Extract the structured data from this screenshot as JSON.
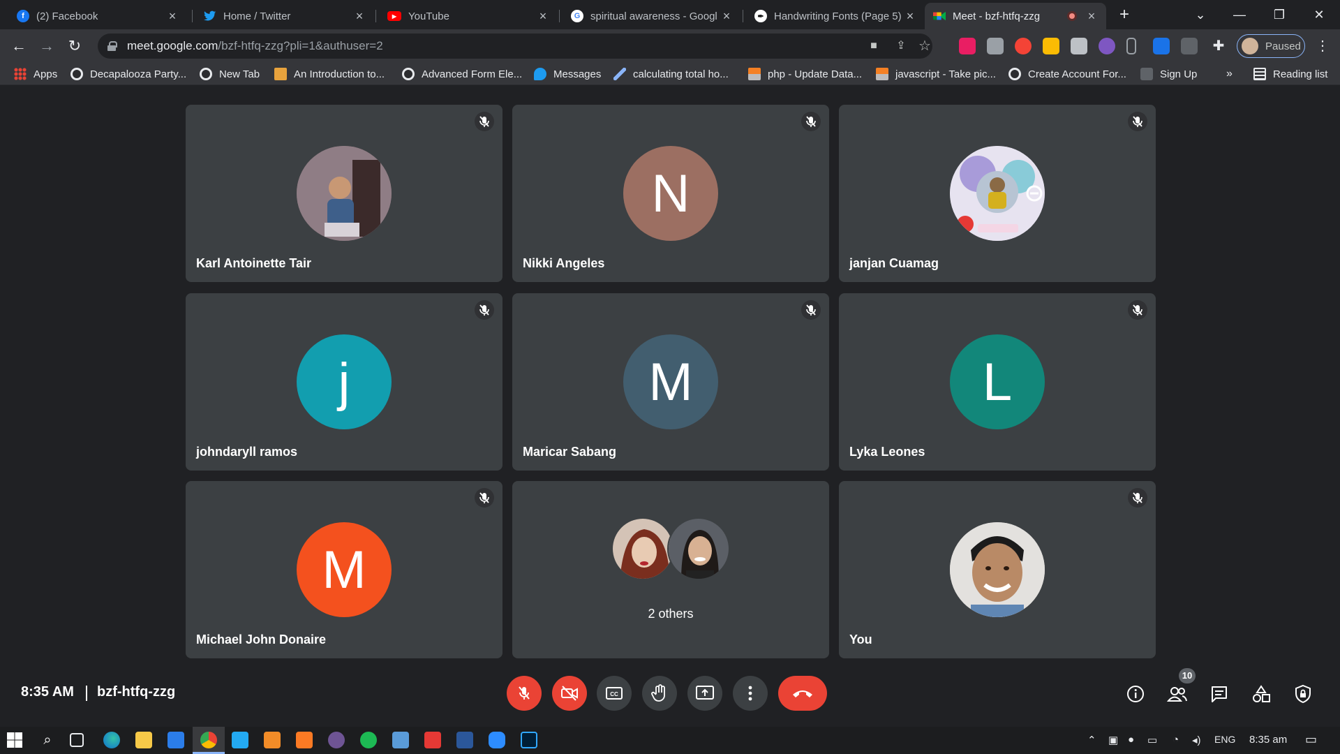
{
  "browser": {
    "tabs": [
      {
        "title": "(2) Facebook",
        "icon": "facebook-icon",
        "color": "#1877f2",
        "glyph": "f"
      },
      {
        "title": "Home / Twitter",
        "icon": "twitter-icon",
        "color": "#1d9bf0",
        "glyph": ""
      },
      {
        "title": "YouTube",
        "icon": "youtube-icon",
        "color": "#ff0000",
        "glyph": "▶"
      },
      {
        "title": "spiritual awareness - Googl",
        "icon": "google-icon",
        "color": "#ffffff",
        "glyph": "G"
      },
      {
        "title": "Handwriting Fonts (Page 5)",
        "icon": "fonts-icon",
        "color": "#111111",
        "glyph": "✒"
      },
      {
        "title": "Meet - bzf-htfq-zzg",
        "icon": "google-meet-icon",
        "color": "#00897b",
        "glyph": "",
        "active": true
      }
    ],
    "new_tab": "+",
    "window": {
      "tab_search": "⌄",
      "minimize": "—",
      "restore": "❐",
      "close": "✕"
    },
    "url": {
      "host": "meet.google.com",
      "path": "/bzf-htfq-zzg?pli=1&authuser=2"
    },
    "profile_status": "Paused",
    "bookmarks": [
      {
        "label": "Apps",
        "icon": "apps-grid-icon"
      },
      {
        "label": "Decapalooza Party...",
        "icon": "globe-icon"
      },
      {
        "label": "New Tab",
        "icon": "globe-icon"
      },
      {
        "label": "An Introduction to...",
        "icon": "bookmark-site-icon"
      },
      {
        "label": "Advanced Form Ele...",
        "icon": "globe-icon"
      },
      {
        "label": "Messages",
        "icon": "twitter-icon"
      },
      {
        "label": "calculating total ho...",
        "icon": "pen-icon"
      },
      {
        "label": "php - Update Data...",
        "icon": "stackoverflow-icon"
      },
      {
        "label": "javascript - Take pic...",
        "icon": "stackoverflow-icon"
      },
      {
        "label": "Create Account For...",
        "icon": "globe-icon"
      },
      {
        "label": "Sign Up",
        "icon": "signup-icon"
      }
    ],
    "bookmarks_overflow": "»",
    "reading_list": "Reading list"
  },
  "meet": {
    "participants": [
      {
        "name": "Karl Antoinette Tair",
        "initial": "",
        "color": "#8d7f86",
        "photo": true
      },
      {
        "name": "Nikki Angeles",
        "initial": "N",
        "color": "#9c6f62"
      },
      {
        "name": "janjan Cuamag",
        "initial": "",
        "color": "#b8c4e0",
        "photo": true
      },
      {
        "name": "johndaryll ramos",
        "initial": "j",
        "color": "#129eaf"
      },
      {
        "name": "Maricar Sabang",
        "initial": "M",
        "color": "#425e6f"
      },
      {
        "name": "Lyka Leones",
        "initial": "L",
        "color": "#12877a"
      },
      {
        "name": "Michael John Donaire",
        "initial": "M",
        "color": "#f4511e"
      },
      {
        "name": "2 others",
        "initial": "",
        "color": "#5f6368",
        "others": true
      },
      {
        "name": "You",
        "initial": "",
        "color": "#b98d6b",
        "photo": true
      }
    ],
    "time": "8:35 AM",
    "meeting_code": "bzf-htfq-zzg",
    "participant_count": "10"
  },
  "taskbar": {
    "language": "ENG",
    "clock": "8:35 am"
  },
  "colors": {
    "stage": "#202124",
    "tile": "#3c4043",
    "danger": "#ea4335"
  }
}
